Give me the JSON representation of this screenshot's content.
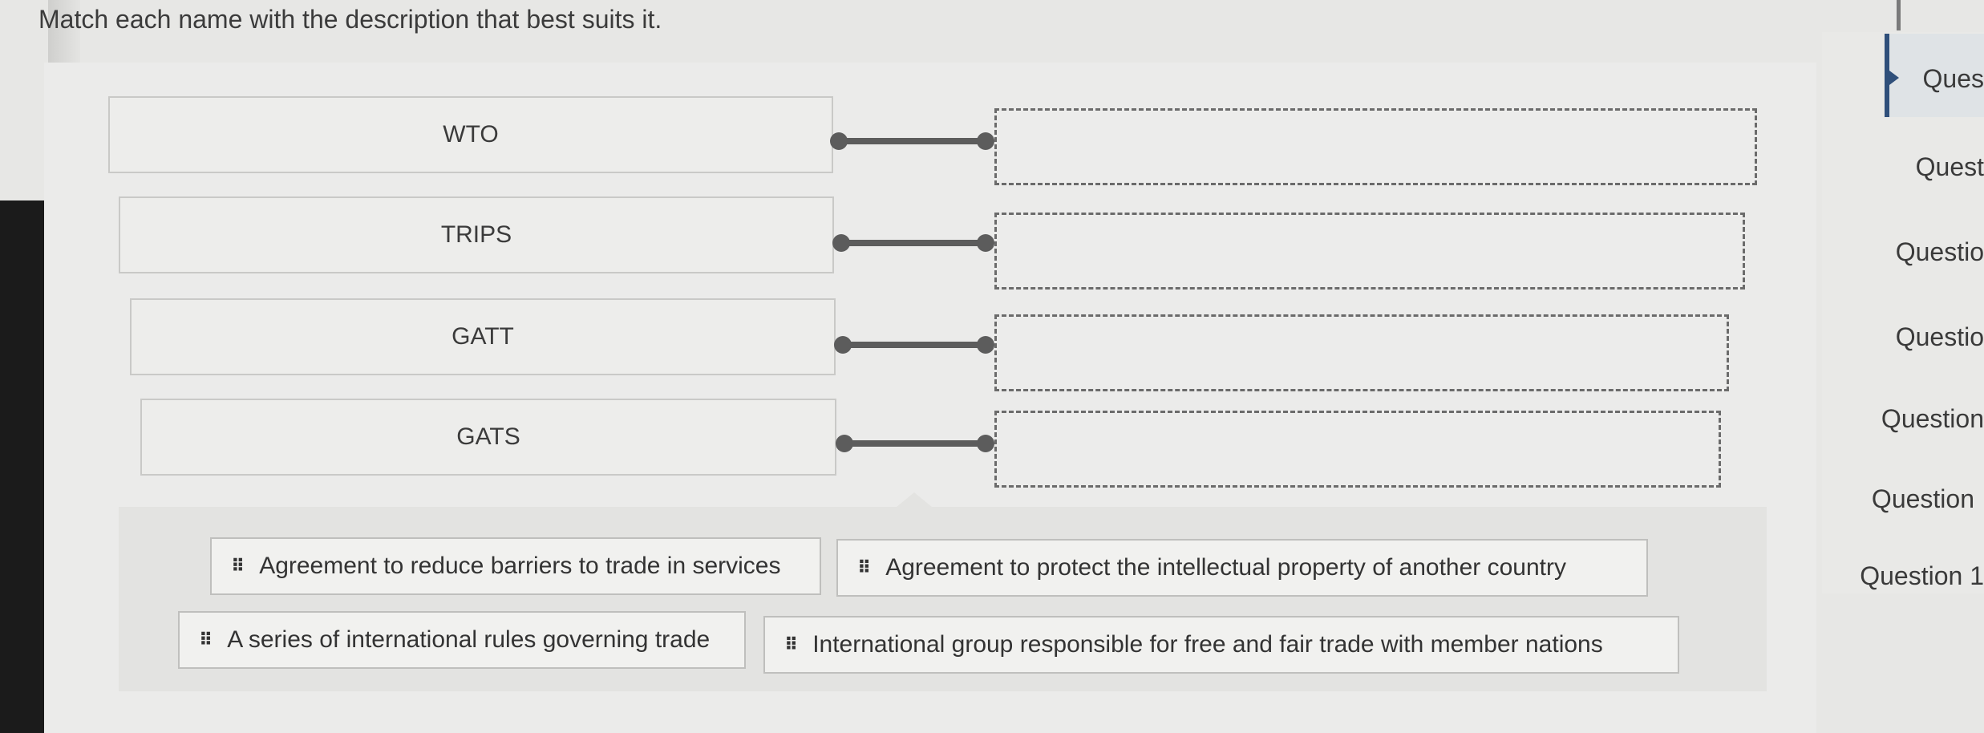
{
  "instruction": "Match each name with the description that best suits it.",
  "names": [
    "WTO",
    "TRIPS",
    "GATT",
    "GATS"
  ],
  "answer_bank": [
    "Agreement to reduce barriers to trade in services",
    "Agreement to protect the intellectual property of another country",
    "A series of international rules governing trade",
    "International group responsible for free and fair trade with member nations"
  ],
  "question_nav": [
    "Ques",
    "Quest",
    "Questio",
    "Questio",
    "Question",
    "Question",
    "Question 1"
  ],
  "colors": {
    "accent": "#2f4f7a",
    "connector": "#5c5c5c",
    "background": "#e7e7e5"
  }
}
